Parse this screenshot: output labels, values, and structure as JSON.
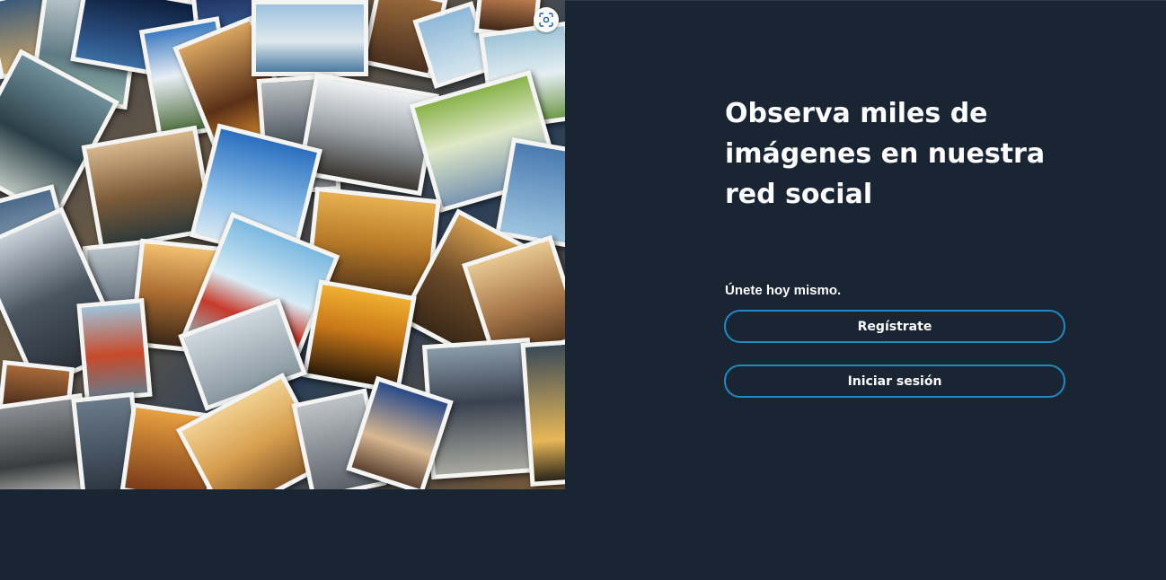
{
  "collage": {
    "alt": "Collage de fotografías de ciudades"
  },
  "hero": {
    "headline": "Observa miles de imágenes en nuestra red social",
    "join_text": "Únete hoy mismo.",
    "register_label": "Regístrate",
    "login_label": "Iniciar sesión"
  },
  "icons": {
    "lens": "visual-search-icon"
  },
  "colors": {
    "background": "#192533",
    "button_border": "#1e8bc3",
    "text": "#ffffff"
  }
}
